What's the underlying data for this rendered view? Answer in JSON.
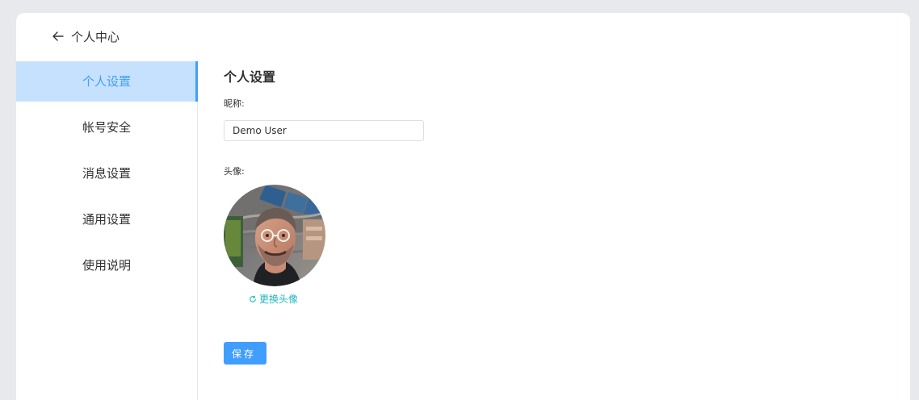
{
  "header": {
    "title": "个人中心",
    "back_icon": "arrow-left-icon"
  },
  "sidebar": {
    "items": [
      {
        "label": "个人设置",
        "active": true
      },
      {
        "label": "帐号安全",
        "active": false
      },
      {
        "label": "消息设置",
        "active": false
      },
      {
        "label": "通用设置",
        "active": false
      },
      {
        "label": "使用说明",
        "active": false
      }
    ]
  },
  "main": {
    "title": "个人设置",
    "nickname": {
      "label": "昵称:",
      "value": "Demo User"
    },
    "avatar": {
      "label": "头像:",
      "icon": "refresh-icon",
      "change_label": "更换头像"
    },
    "save_label": "保存"
  },
  "colors": {
    "background": "#e8e9ec",
    "card": "#ffffff",
    "accent": "#409eff",
    "active_nav": "#c6e1fd",
    "link": "#1fb7c1",
    "text": "#303133",
    "border": "#dcdfe6"
  }
}
